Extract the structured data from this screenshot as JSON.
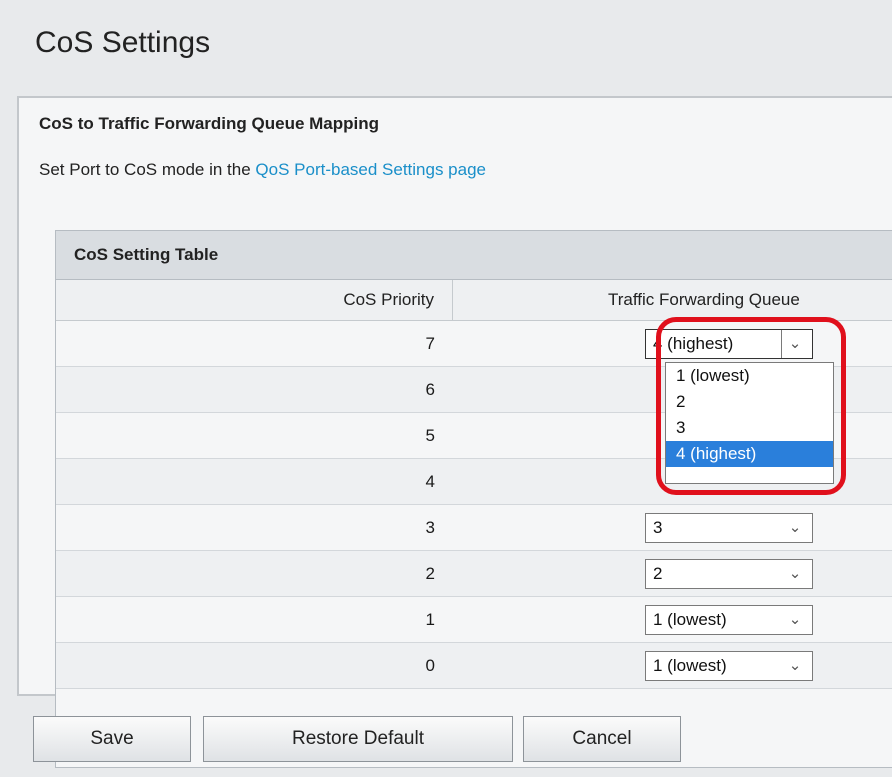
{
  "page": {
    "title": "CoS Settings"
  },
  "section": {
    "title": "CoS to Traffic Forwarding Queue Mapping",
    "hint_prefix": "Set Port to CoS mode in the ",
    "hint_link": "QoS Port-based Settings page"
  },
  "table": {
    "caption": "CoS Setting Table",
    "headers": {
      "priority": "CoS Priority",
      "queue": "Traffic Forwarding Queue"
    },
    "rows": [
      {
        "priority": "7",
        "queue": "4 (highest)"
      },
      {
        "priority": "6",
        "queue": ""
      },
      {
        "priority": "5",
        "queue": ""
      },
      {
        "priority": "4",
        "queue": ""
      },
      {
        "priority": "3",
        "queue": "3"
      },
      {
        "priority": "2",
        "queue": "2"
      },
      {
        "priority": "1",
        "queue": "1 (lowest)"
      },
      {
        "priority": "0",
        "queue": "1 (lowest)"
      }
    ]
  },
  "dropdown": {
    "options": [
      "1 (lowest)",
      "2",
      "3",
      "4 (highest)"
    ],
    "selected": "4 (highest)"
  },
  "buttons": {
    "save": "Save",
    "restore": "Restore Default",
    "cancel": "Cancel"
  },
  "icons": {
    "select_arrow": "chevron-down-icon"
  },
  "colors": {
    "link": "#1a8fc9",
    "highlight": "#e0101c",
    "selected_option": "#2a7fdb"
  }
}
